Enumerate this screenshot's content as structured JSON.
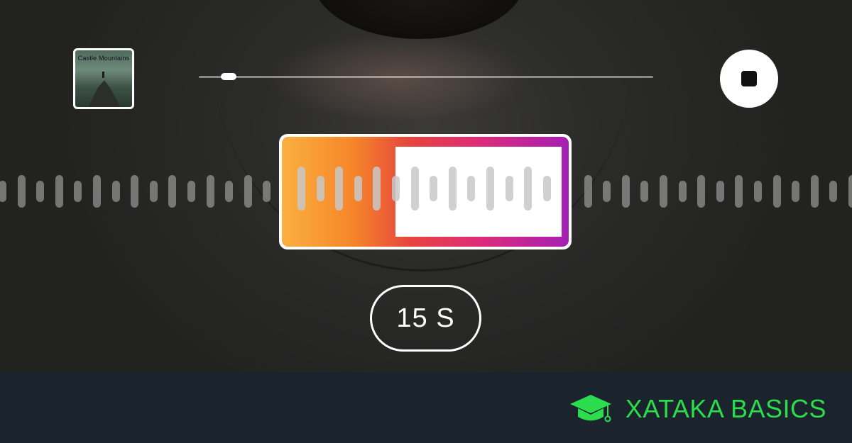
{
  "player": {
    "song_cover": {
      "title_text": "Castle Mountains",
      "icon": "album-cover"
    },
    "progress_fraction": 0.065,
    "stop_icon": "stop-square-icon"
  },
  "clip_selector": {
    "duration_label": "15 S",
    "gradient_colors": [
      "#fbb040",
      "#f58529",
      "#e6443f",
      "#dd2a7b",
      "#a51fb5"
    ]
  },
  "footer": {
    "brand_name": "XATAKA BASICS",
    "brand_icon": "graduation-cap-icon",
    "brand_color": "#2bdc4c"
  }
}
